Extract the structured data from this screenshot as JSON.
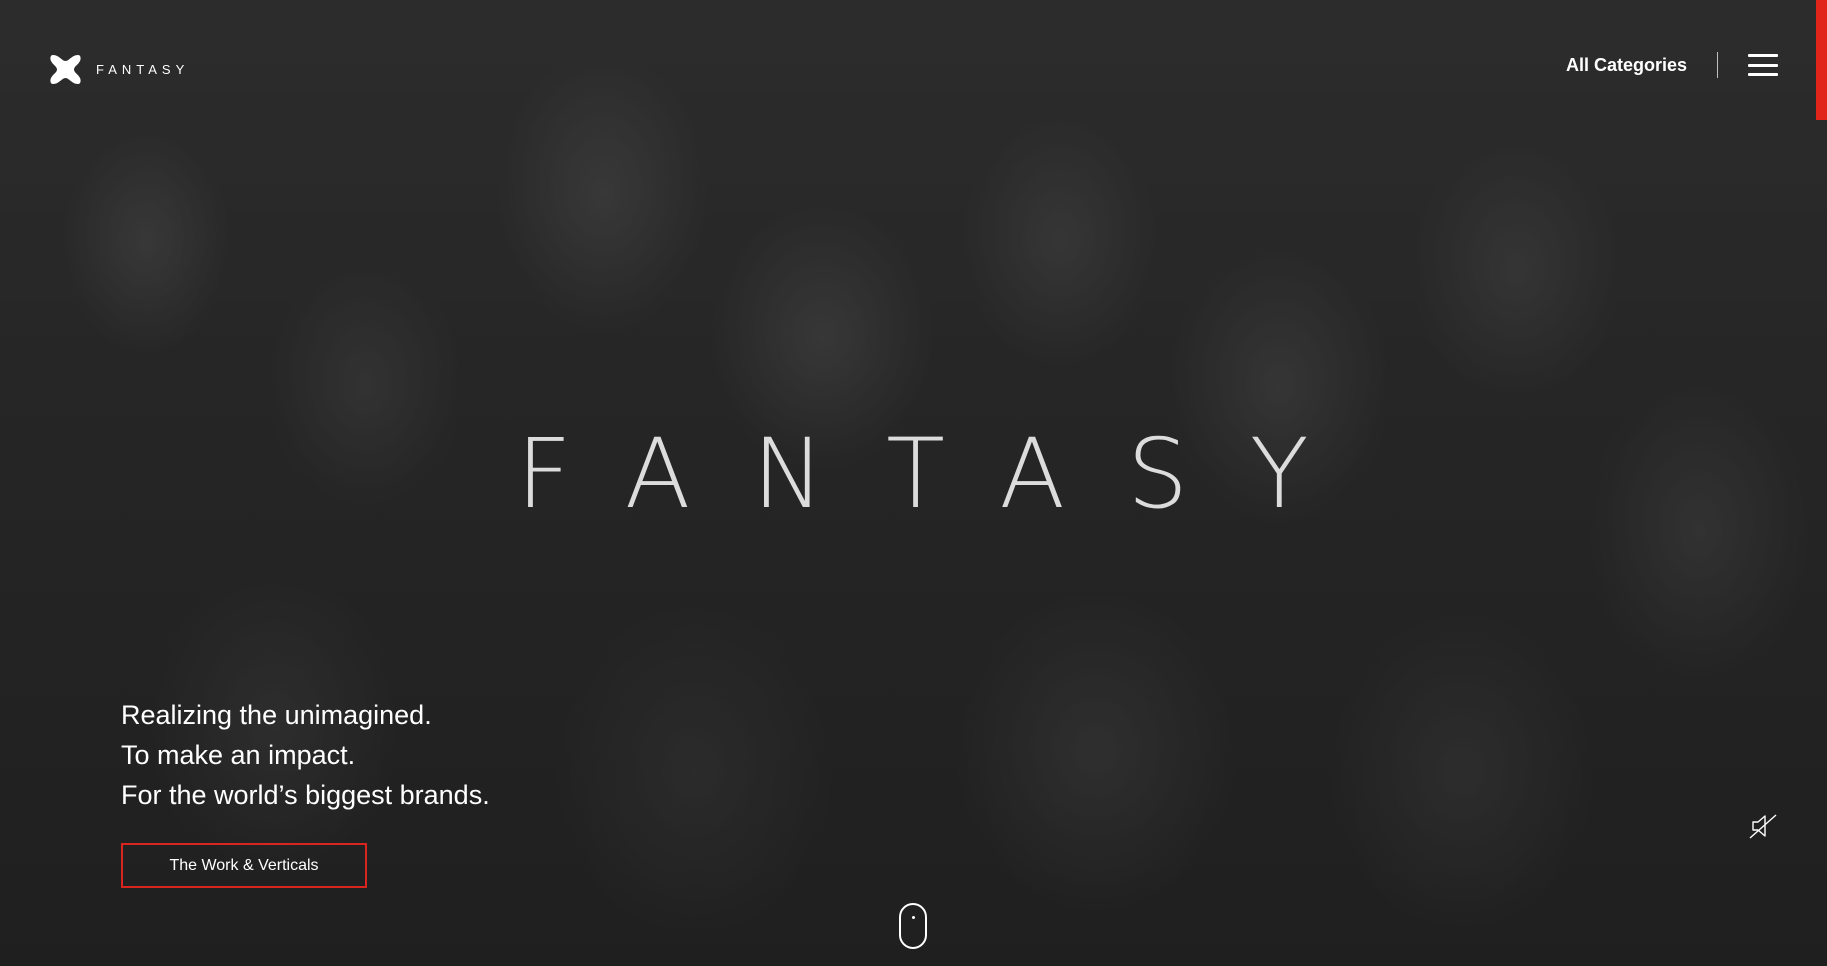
{
  "header": {
    "logo_text": "FANTASY",
    "nav_label": "All Categories",
    "menu_icon": "hamburger-menu-icon"
  },
  "hero": {
    "wordmark": "FANTASY",
    "taglines": [
      "Realizing the unimagined.",
      "To make an impact.",
      "For the world’s biggest brands."
    ],
    "cta_label": "The Work & Verticals",
    "background": "grayscale crowd photo with raised hands"
  },
  "controls": {
    "mute_icon": "speaker-muted-icon",
    "scroll_icon": "scroll-mouse-icon"
  },
  "colors": {
    "accent": "#e1251b",
    "text": "#ffffff",
    "background": "#2b2b2b"
  }
}
